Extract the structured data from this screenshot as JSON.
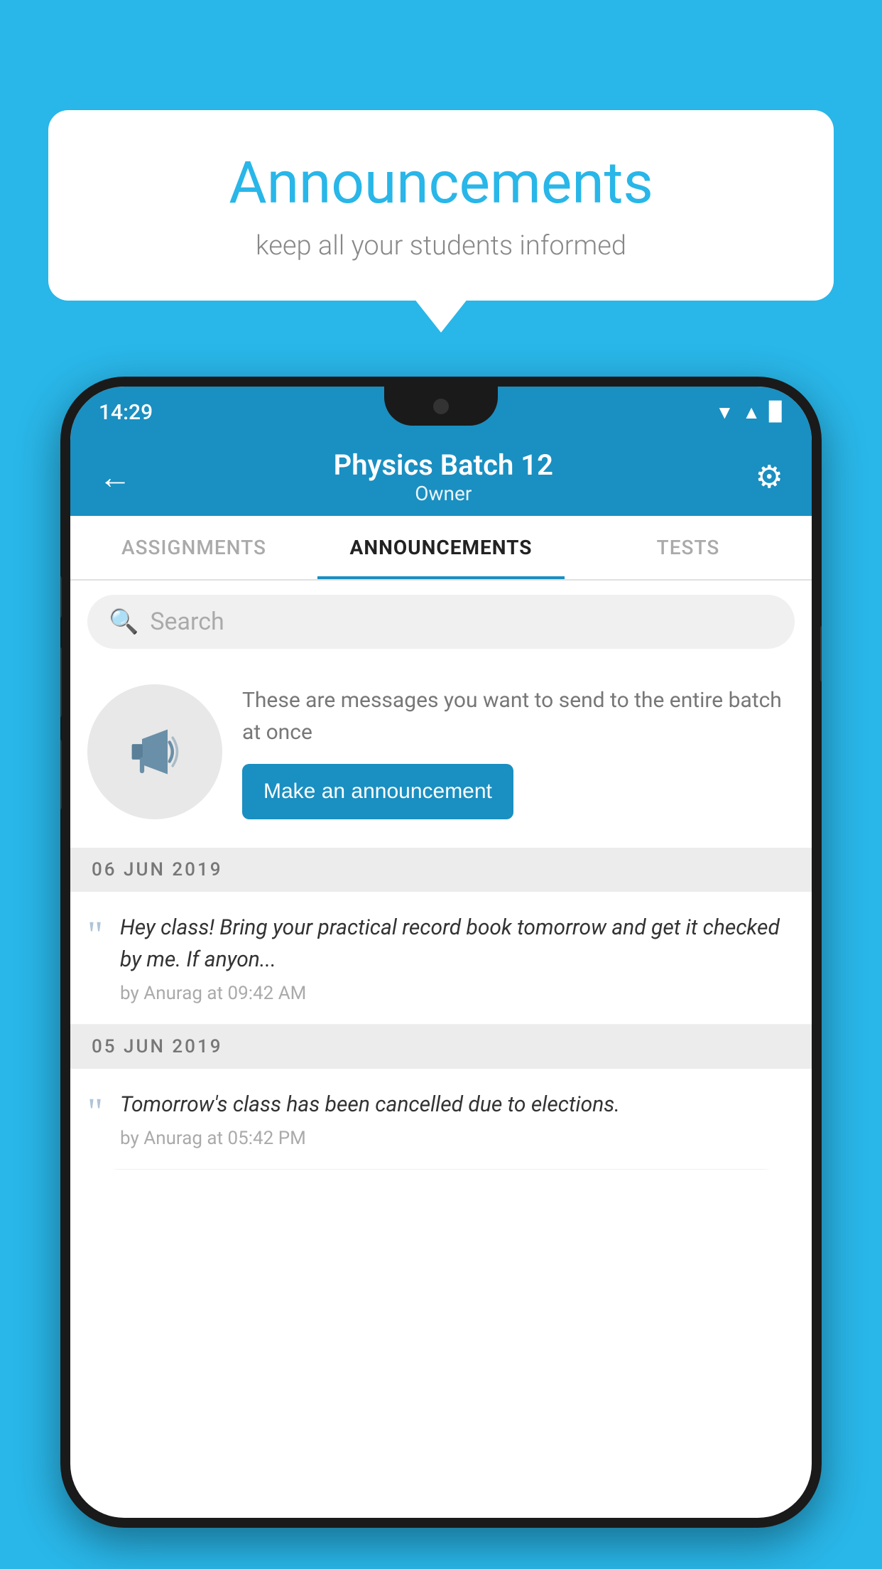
{
  "background_color": "#29b6e8",
  "speech_bubble": {
    "title": "Announcements",
    "subtitle": "keep all your students informed"
  },
  "phone": {
    "status_bar": {
      "time": "14:29",
      "icons": [
        "wifi",
        "signal",
        "battery"
      ]
    },
    "header": {
      "back_label": "←",
      "title": "Physics Batch 12",
      "subtitle": "Owner",
      "settings_icon": "⚙"
    },
    "tabs": [
      {
        "label": "ASSIGNMENTS",
        "active": false
      },
      {
        "label": "ANNOUNCEMENTS",
        "active": true
      },
      {
        "label": "TESTS",
        "active": false
      }
    ],
    "search": {
      "placeholder": "Search"
    },
    "promo": {
      "text": "These are messages you want to send to the entire batch at once",
      "button_label": "Make an announcement"
    },
    "announcements": [
      {
        "date": "06  JUN  2019",
        "text": "Hey class! Bring your practical record book tomorrow and get it checked by me. If anyon...",
        "meta": "by Anurag at 09:42 AM"
      },
      {
        "date": "05  JUN  2019",
        "text": "Tomorrow's class has been cancelled due to elections.",
        "meta": "by Anurag at 05:42 PM"
      }
    ]
  }
}
